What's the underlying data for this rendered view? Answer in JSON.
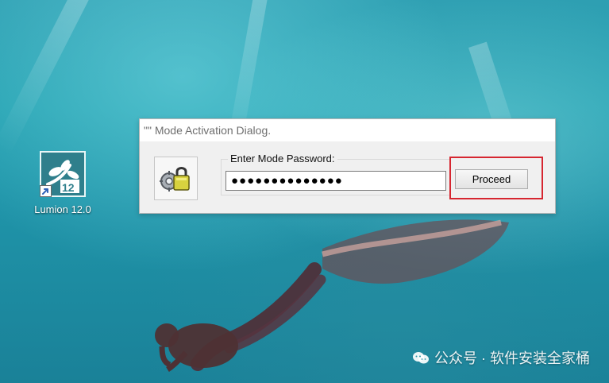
{
  "desktop": {
    "shortcut": {
      "label": "Lumion 12.0",
      "badge": "12",
      "icon": "lumion-logo-icon"
    }
  },
  "dialog": {
    "title": "\"\" Mode Activation Dialog.",
    "group_label": "Enter Mode Password:",
    "password_value": "●●●●●●●●●●●●●●",
    "proceed_label": "Proceed",
    "lock_icon": "lock-gear-icon",
    "highlight_color": "#d62630"
  },
  "watermark": {
    "text": "公众号 · 软件安装全家桶",
    "icon": "wechat-icon"
  },
  "colors": {
    "dialog_bg": "#f0f0f0",
    "title_text": "#6f6f6f",
    "desktop_water": "#1f93a8"
  }
}
